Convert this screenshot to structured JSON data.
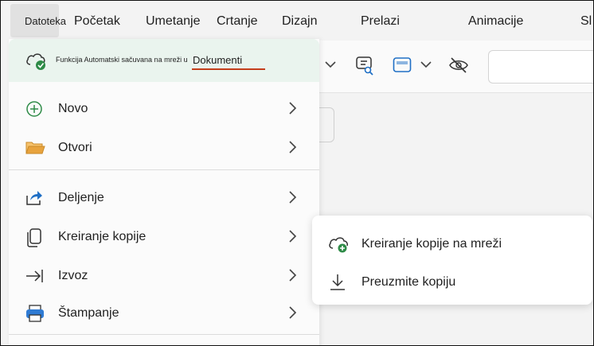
{
  "ribbon": {
    "tabs": [
      {
        "label": "Datoteka"
      },
      {
        "label": "Početak"
      },
      {
        "label": "Umetanje"
      },
      {
        "label": "Crtanje"
      },
      {
        "label": "Dizajn"
      },
      {
        "label": "Prelazi"
      },
      {
        "label": "Animacije"
      },
      {
        "label": "Sl"
      }
    ]
  },
  "file_menu": {
    "autosave_text": "Funkcija Automatski sačuvana na mreži u",
    "autosave_location": "Dokumenti",
    "items": [
      {
        "label": "Novo",
        "icon": "new-icon"
      },
      {
        "label": "Otvori",
        "icon": "folder-icon"
      },
      {
        "label": "Deljenje",
        "icon": "share-icon"
      },
      {
        "label": "Kreiranje kopije",
        "icon": "copy-icon"
      },
      {
        "label": "Izvoz",
        "icon": "export-icon"
      },
      {
        "label": "Štampanje",
        "icon": "printer-icon"
      }
    ]
  },
  "submenu": {
    "items": [
      {
        "label": "Kreiranje kopije na mreži",
        "icon": "cloud-add-icon"
      },
      {
        "label": "Preuzmite kopiju",
        "icon": "download-icon"
      }
    ]
  },
  "colors": {
    "accent": "#c43e1c",
    "autosave_bg": "#eaf4ee",
    "new_icon_green": "#2e8b47",
    "folder_orange": "#e8a33d",
    "share_blue": "#1f6fc5",
    "printer_blue": "#2f7bd3"
  }
}
